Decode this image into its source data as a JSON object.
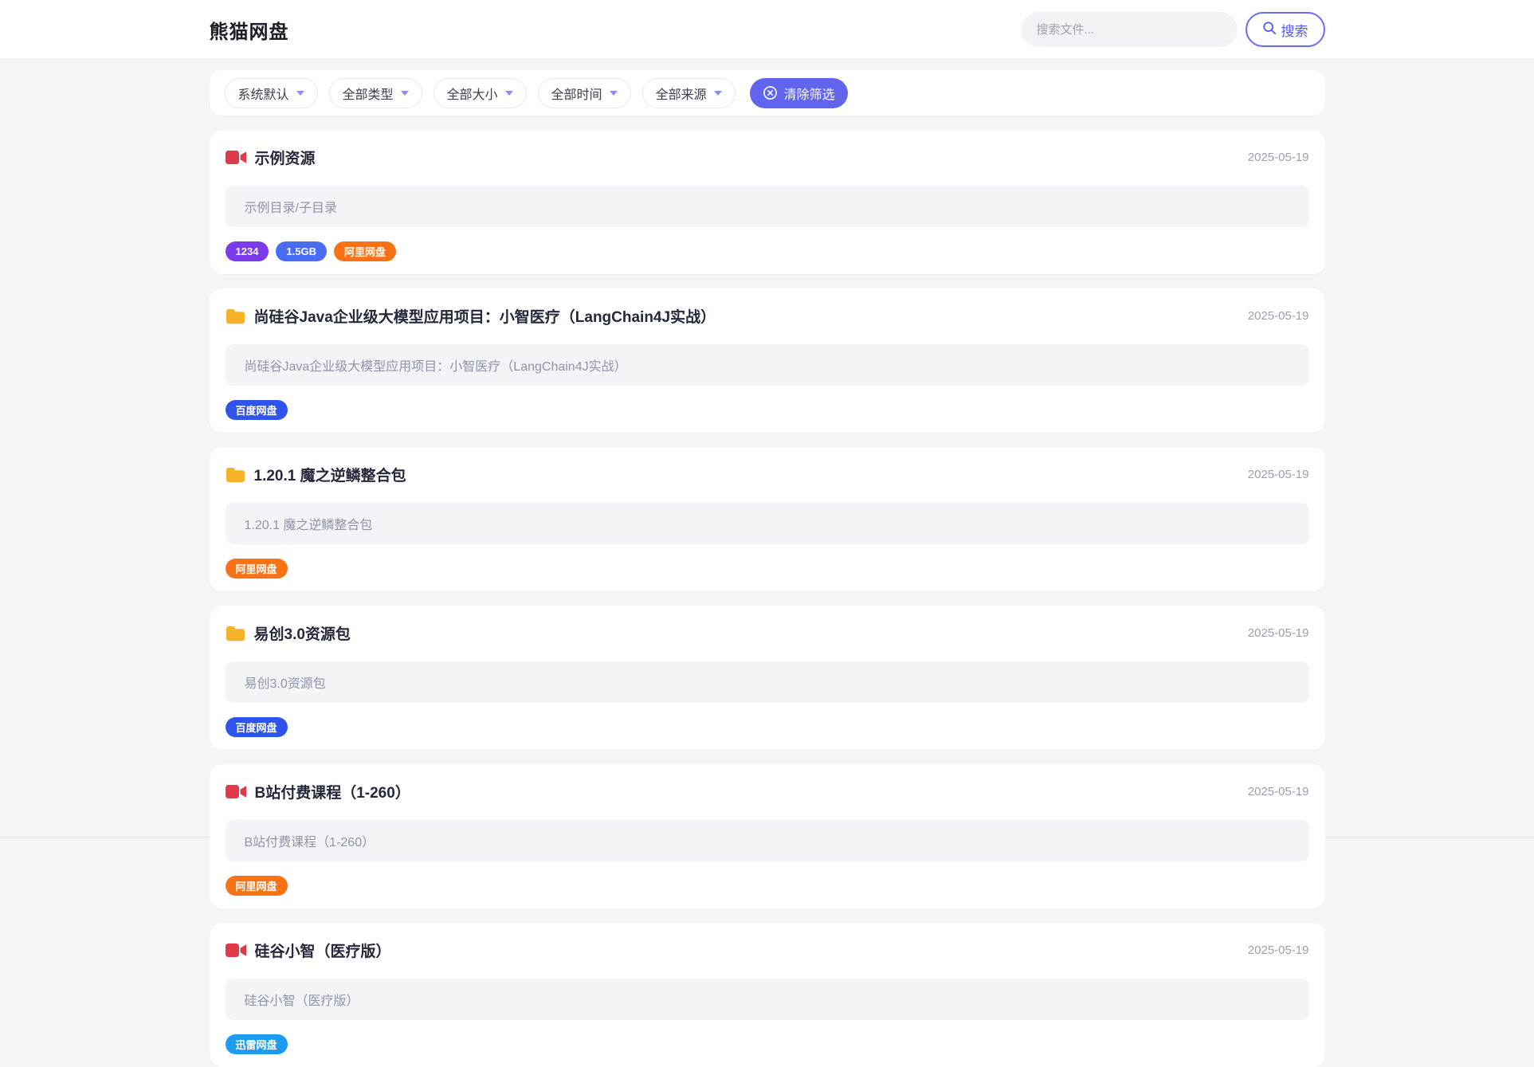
{
  "header": {
    "logo": "熊猫网盘",
    "search_placeholder": "搜索文件...",
    "search_button": "搜索"
  },
  "filters": {
    "items": [
      {
        "label": "系统默认"
      },
      {
        "label": "全部类型"
      },
      {
        "label": "全部大小"
      },
      {
        "label": "全部时间"
      },
      {
        "label": "全部来源"
      }
    ],
    "clear_label": "清除筛选"
  },
  "cards": [
    {
      "icon": "video-icon",
      "title": "示例资源",
      "date": "2025-05-19",
      "description": "示例目录/子目录",
      "tags": [
        {
          "label": "1234",
          "color": "#7c3aed"
        },
        {
          "label": "1.5GB",
          "color": "#4a6cf5"
        },
        {
          "label": "阿里网盘",
          "color": "#f97316"
        }
      ]
    },
    {
      "icon": "folder-icon",
      "title": "尚硅谷Java企业级大模型应用项目：小智医疗（LangChain4J实战）",
      "date": "2025-05-19",
      "description": "尚硅谷Java企业级大模型应用项目：小智医疗（LangChain4J实战）",
      "tags": [
        {
          "label": "百度网盘",
          "color": "#2f54eb"
        }
      ]
    },
    {
      "icon": "folder-icon",
      "title": "1.20.1 魔之逆鳞整合包",
      "date": "2025-05-19",
      "description": "1.20.1 魔之逆鳞整合包",
      "tags": [
        {
          "label": "阿里网盘",
          "color": "#f97316"
        }
      ]
    },
    {
      "icon": "folder-icon",
      "title": "易创3.0资源包",
      "date": "2025-05-19",
      "description": "易创3.0资源包",
      "tags": [
        {
          "label": "百度网盘",
          "color": "#2f54eb"
        }
      ]
    },
    {
      "icon": "video-icon",
      "title": "B站付费课程（1-260）",
      "date": "2025-05-19",
      "description": "B站付费课程（1-260）",
      "tags": [
        {
          "label": "阿里网盘",
          "color": "#f97316"
        }
      ]
    },
    {
      "icon": "video-icon",
      "title": "硅谷小智（医疗版）",
      "date": "2025-05-19",
      "description": "硅谷小智（医疗版）",
      "tags": [
        {
          "label": "迅雷网盘",
          "color": "#1d9bf0"
        }
      ]
    }
  ],
  "colors": {
    "accent": "#6165ee",
    "video_icon": "#e0394a",
    "folder_icon": "#f5b32a",
    "page_bg": "#f4f5f7"
  }
}
